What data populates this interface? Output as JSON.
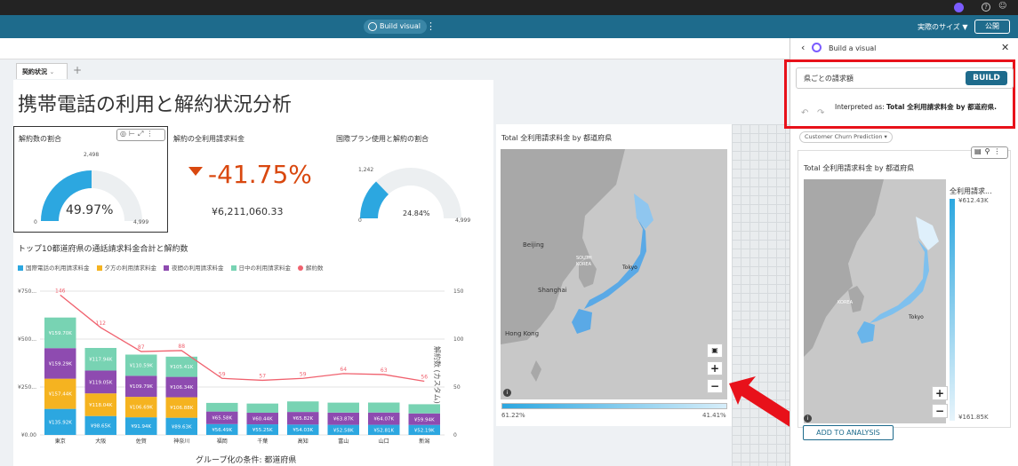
{
  "toolbar": {
    "build_visual": "Build visual",
    "size_select": "実際のサイズ",
    "publish": "公開"
  },
  "tab": {
    "label": "契約状況"
  },
  "page_title": "携帯電話の利用と解約状況分析",
  "kpi1": {
    "title": "解約数の割合",
    "value": "49.97%",
    "max_label": "2,498",
    "min": "0",
    "max": "4,999"
  },
  "kpi2": {
    "title": "解約の全利用請求料金",
    "value": "-41.75%",
    "sub": "¥6,211,060.33"
  },
  "kpi3": {
    "title": "国際プラン使用と解約の割合",
    "value": "24.84%",
    "max_label": "1,242",
    "min": "0",
    "max": "4,999"
  },
  "combo": {
    "title": "トップ10都道府県の通話請求料金合計と解約数",
    "xlabel": "グループ化の条件: 都道府県",
    "ylabel2": "解約数 (カスタム)"
  },
  "map": {
    "title": "Total 全利用請求料金 by 都道府県",
    "legend_min": "61.22%",
    "legend_max": "41.41%",
    "labels": {
      "beijing": "Beijing",
      "shanghai": "Shanghai",
      "hongkong": "Hong Kong",
      "tokyo": "Tokyo",
      "south": "SOUTH",
      "korea": "KOREA"
    }
  },
  "panel": {
    "header": "Build a visual",
    "query": "県ごとの請求額",
    "build": "BUILD",
    "interpreted_prefix": "Interpreted as: ",
    "interpreted_bold": "Total 全利用請求料金 by 都道府県.",
    "topic": "Customer Churn Prediction",
    "visual_title": "Total 全利用請求料金 by 都道府県",
    "legend_title": "全利用請求...",
    "legend_max": "¥612.43K",
    "legend_min": "¥161.85K",
    "add_button": "ADD TO ANALYSIS",
    "tokyo": "Tokyo",
    "korea": "KOREA"
  },
  "colors": {
    "toolbar": "#1e6b8c",
    "accent": "#2ca7e0",
    "kpi_negative": "#d9480f",
    "highlight": "#e8111a"
  },
  "chart_data": {
    "type": "bar",
    "categories": [
      "東京",
      "大阪",
      "佐賀",
      "神奈川",
      "福岡",
      "千葉",
      "高知",
      "富山",
      "山口",
      "新潟"
    ],
    "series": [
      {
        "name": "国際電話の利用請求料金",
        "color": "#2ca7e0",
        "values": [
          135.92,
          98.65,
          91.94,
          89.63,
          56.49,
          55.25,
          54.03,
          52.58,
          52.81,
          52.19
        ],
        "labels": [
          "¥135.92K",
          "¥98.65K",
          "¥91.94K",
          "¥89.63K",
          "¥56.49K",
          "¥55.25K",
          "¥54.03K",
          "¥52.58K",
          "¥52.81K",
          "¥52.19K"
        ]
      },
      {
        "name": "夕方の利用請求料金",
        "color": "#f5b320",
        "values": [
          157.44,
          118.04,
          106.69,
          106.88,
          0,
          0,
          0,
          0,
          0,
          0
        ],
        "labels": [
          "¥157.44K",
          "¥118.04K",
          "¥106.69K",
          "¥106.88K",
          "",
          "",
          "",
          "",
          "",
          ""
        ]
      },
      {
        "name": "夜間の利用請求料金",
        "color": "#8e4bb0",
        "values": [
          159.29,
          119.05,
          109.79,
          106.34,
          65.58,
          60.44,
          65.82,
          63.87,
          64.07,
          59.94
        ],
        "labels": [
          "¥159.29K",
          "¥119.05K",
          "¥109.79K",
          "¥106.34K",
          "¥65.58K",
          "¥60.44K",
          "¥65.82K",
          "¥63.87K",
          "¥64.07K",
          "¥59.94K"
        ]
      },
      {
        "name": "日中の利用請求料金",
        "color": "#78d3b3",
        "values": [
          159.7,
          117.94,
          110.59,
          105.41,
          45,
          48,
          55,
          52,
          52,
          48
        ],
        "labels": [
          "¥159.70K",
          "¥117.94K",
          "¥110.59K",
          "¥105.41K",
          "",
          "",
          "",
          "",
          "",
          ""
        ]
      },
      {
        "name": "解約数",
        "color": "#f0616e",
        "type": "line",
        "values": [
          146,
          112,
          87,
          88,
          59,
          57,
          59,
          64,
          63,
          56
        ]
      }
    ],
    "yticks": [
      "¥0.00",
      "¥250...",
      "¥500...",
      "¥750..."
    ],
    "y2ticks": [
      "0",
      "50",
      "100",
      "150"
    ],
    "ylim": [
      0,
      750
    ],
    "y2lim": [
      0,
      150
    ]
  }
}
